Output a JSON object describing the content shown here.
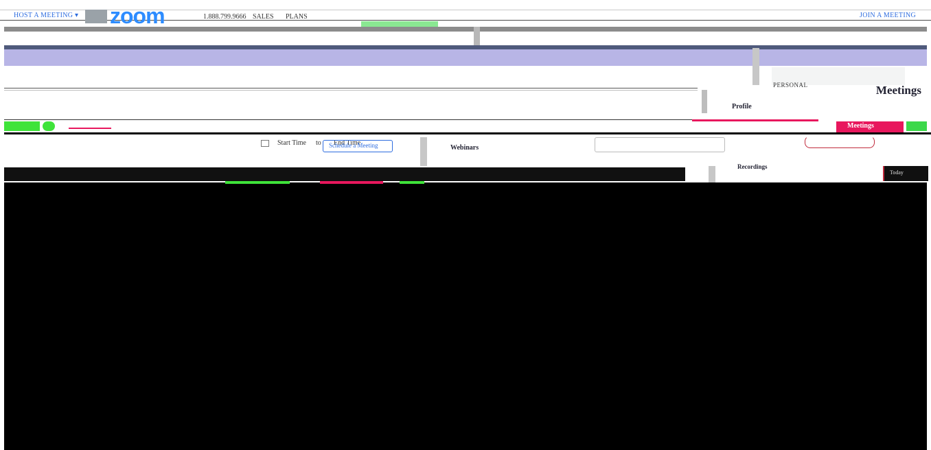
{
  "header": {
    "host_meeting": "HOST A MEETING ▾",
    "logo_text": "zoom",
    "phone": "1.888.799.9666",
    "sales": "SALES",
    "plans": "PLANS",
    "join_meeting": "JOIN A MEETING"
  },
  "sidebar": {
    "section_label": "PERSONAL",
    "items": [
      {
        "label": "Profile"
      },
      {
        "label": "Meetings"
      },
      {
        "label": "Webinars"
      },
      {
        "label": "Recordings"
      }
    ]
  },
  "meetings": {
    "page_title": "Meetings",
    "schedule_button": "Schedule a Meeting",
    "start_time_label": "Start Time",
    "to_label": "to",
    "end_time_label": "End Time",
    "today_badge": "Today"
  },
  "colors": {
    "brand_blue": "#2d8cff",
    "accent_pink": "#e8175d",
    "accent_green": "#3cd84a",
    "banner_lavender": "#b8b5e6"
  }
}
